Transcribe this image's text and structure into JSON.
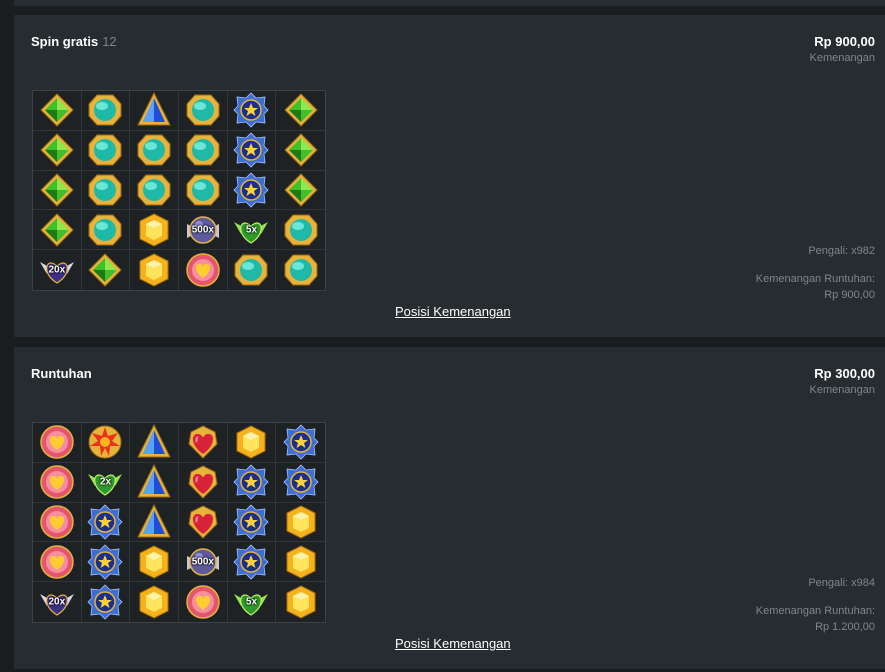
{
  "rounds": [
    {
      "title": "Spin gratis",
      "count": "12",
      "amount": "Rp 900,00",
      "amount_label": "Kemenangan",
      "multiplier_label": "Pengali: x982",
      "cascade_label": "Kemenangan Runtuhan:",
      "cascade_value": "Rp 900,00",
      "link_label": "Posisi Kemenangan",
      "grid": [
        [
          "green-gem",
          "cyan-gem",
          "blue-pyramid-gem",
          "cyan-gem",
          "blue-star-gem",
          "green-gem"
        ],
        [
          "green-gem",
          "cyan-gem",
          "cyan-gem",
          "cyan-gem",
          "blue-star-gem",
          "green-gem"
        ],
        [
          "green-gem",
          "cyan-gem",
          "cyan-gem",
          "cyan-gem",
          "blue-star-gem",
          "green-gem"
        ],
        [
          "green-gem",
          "cyan-gem",
          "yellow-gem",
          "multiplier-orb",
          "green-multiplier-heart",
          "cyan-gem"
        ],
        [
          "purple-multiplier-heart",
          "green-gem",
          "yellow-gem",
          "pink-heart-gem",
          "cyan-gem",
          "cyan-gem"
        ]
      ],
      "multipliers": {
        "3-3": "500x",
        "3-4": "5x",
        "4-0": "20x"
      }
    },
    {
      "title": "Runtuhan",
      "count": "",
      "amount": "Rp 300,00",
      "amount_label": "Kemenangan",
      "multiplier_label": "Pengali: x984",
      "cascade_label": "Kemenangan Runtuhan:",
      "cascade_value": "Rp 1.200,00",
      "link_label": "Posisi Kemenangan",
      "grid": [
        [
          "pink-heart-gem",
          "red-sun-gem",
          "blue-pyramid-gem",
          "red-heart-gem",
          "yellow-gem",
          "blue-star-gem"
        ],
        [
          "pink-heart-gem",
          "green-multiplier-heart",
          "blue-pyramid-gem",
          "red-heart-gem",
          "blue-star-gem",
          "blue-star-gem"
        ],
        [
          "pink-heart-gem",
          "blue-star-gem",
          "blue-pyramid-gem",
          "red-heart-gem",
          "blue-star-gem",
          "yellow-gem"
        ],
        [
          "pink-heart-gem",
          "blue-star-gem",
          "yellow-gem",
          "multiplier-orb",
          "blue-star-gem",
          "yellow-gem"
        ],
        [
          "purple-multiplier-heart",
          "blue-star-gem",
          "yellow-gem",
          "pink-heart-gem",
          "green-multiplier-heart",
          "yellow-gem"
        ]
      ],
      "multipliers": {
        "1-1": "2x",
        "3-3": "500x",
        "4-0": "20x",
        "4-4": "5x"
      }
    }
  ],
  "colors": {
    "background": "#1b1e21",
    "panel": "#262c30",
    "muted_text": "#7f868c",
    "count_text": "#7d858b"
  }
}
